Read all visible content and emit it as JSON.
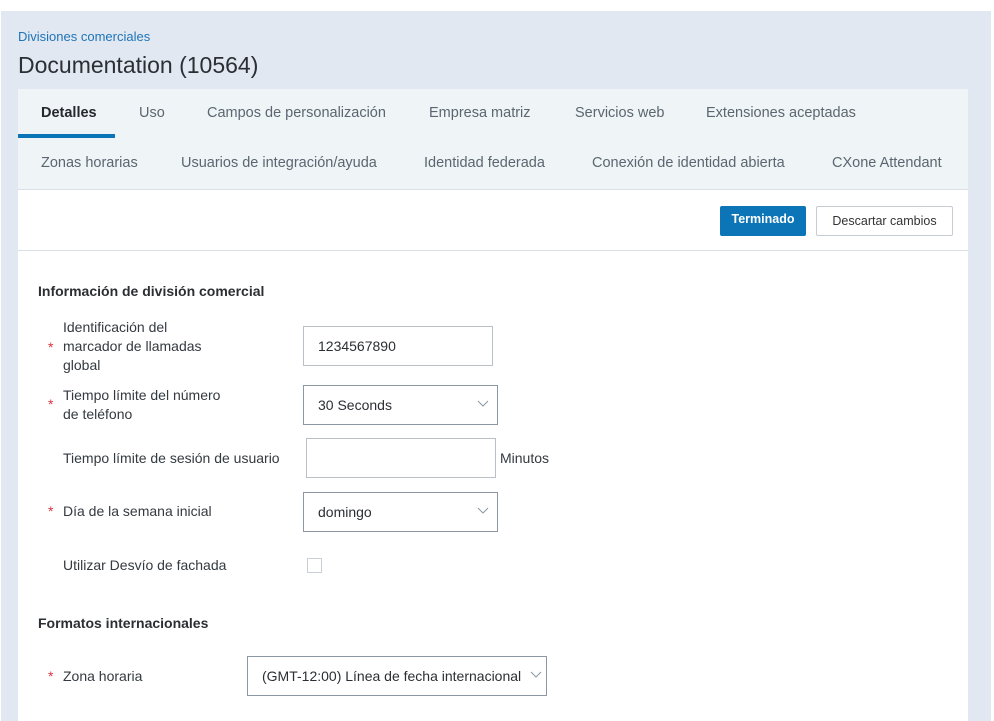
{
  "breadcrumb": "Divisiones comerciales",
  "title": "Documentation (10564)",
  "tabs_row1": [
    {
      "label": "Detalles",
      "active": true
    },
    {
      "label": "Uso"
    },
    {
      "label": "Campos de personalización"
    },
    {
      "label": "Empresa matriz"
    },
    {
      "label": "Servicios web"
    },
    {
      "label": "Extensiones aceptadas"
    }
  ],
  "tabs_row2": [
    {
      "label": "Zonas horarias"
    },
    {
      "label": "Usuarios de integración/ayuda"
    },
    {
      "label": "Identidad federada"
    },
    {
      "label": "Conexión de identidad abierta"
    },
    {
      "label": "CXone Attendant"
    }
  ],
  "toolbar": {
    "done_label": "Terminado",
    "discard_label": "Descartar cambios"
  },
  "colors": {
    "accent": "#0b75b8",
    "required": "#e0323c",
    "panel_bg": "#e1e8f1"
  },
  "section1": {
    "title": "Información de división comercial",
    "fields": {
      "caller_id": {
        "label_lines": [
          "Identificación del",
          "marcador de llamadas",
          "global"
        ],
        "required": "*",
        "value": "1234567890"
      },
      "phone_timeout": {
        "label_lines": [
          "Tiempo límite del número",
          "de teléfono"
        ],
        "required": "*",
        "value": "30 Seconds"
      },
      "session_timeout": {
        "label": "Tiempo límite de sesión de usuario",
        "value": "",
        "suffix": "Minutos"
      },
      "week_start": {
        "label": "Día de la semana inicial",
        "required": "*",
        "value": "domingo"
      },
      "facade_bypass": {
        "label": "Utilizar Desvío de fachada",
        "checked": false
      }
    }
  },
  "section2": {
    "title": "Formatos internacionales",
    "fields": {
      "timezone": {
        "label": "Zona horaria",
        "required": "*",
        "value": "(GMT-12:00) Línea de fecha internacional"
      }
    }
  }
}
